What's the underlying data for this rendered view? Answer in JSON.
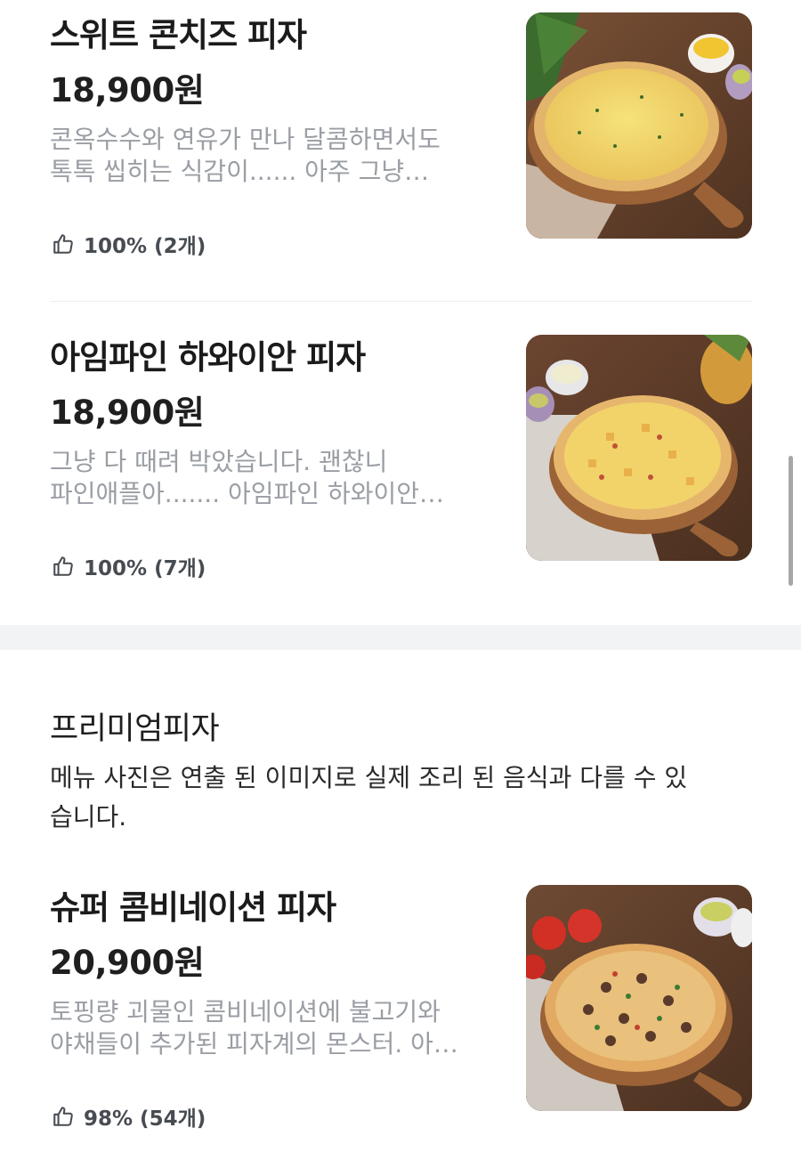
{
  "menu": {
    "items": [
      {
        "name": "스위트 콘치즈 피자",
        "price": "18,900원",
        "description": [
          "콘옥수수와 연유가 만나 달콤하면서도",
          "톡톡 씹히는 식감이...... 아주 그냥…"
        ],
        "rating": "100% (2개)",
        "image": "sweet-corn-cheese-pizza-photo"
      },
      {
        "name": "아임파인 하와이안 피자",
        "price": "18,900원",
        "description": [
          "그냥 다 때려 박았습니다. 괜찮니",
          "파인애플아....... 아임파인 하와이안…"
        ],
        "rating": "100% (7개)",
        "image": "hawaiian-pizza-photo"
      }
    ]
  },
  "premium_section": {
    "title": "프리미엄피자",
    "note": "메뉴 사진은 연출 된 이미지로 실제 조리 된 음식과 다를 수 있습니다.",
    "items": [
      {
        "name": "슈퍼 콤비네이션 피자",
        "price": "20,900원",
        "description": [
          "토핑량 괴물인 콤비네이션에 불고기와",
          "야채들이 추가된 피자계의 몬스터. 아…"
        ],
        "rating": "98% (54개)",
        "image": "super-combination-pizza-photo"
      }
    ]
  },
  "icons": {
    "rating": "thumbs-up-icon"
  },
  "colors": {
    "price": "#1f1f1f",
    "description": "#9a9ea4",
    "rating": "#474c52",
    "section_gap": "#f2f3f5"
  }
}
